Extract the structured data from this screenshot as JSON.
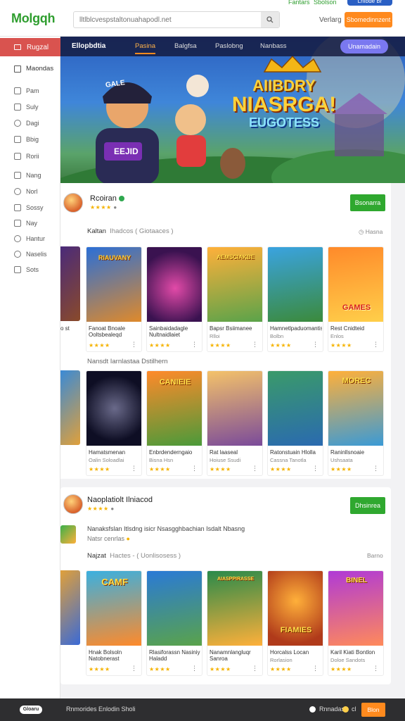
{
  "header": {
    "logo": "Molgqh",
    "search_placeholder": "lltlblcvespstaltonuahapodl.net",
    "top_link_a": "Fantars",
    "top_link_b": "Sbolson",
    "top_pill": "Lnfbde Br",
    "user_link": "Verlarg",
    "primary_button": "Sbomedinnzent"
  },
  "sidebar": {
    "active_item": "Rugzal",
    "main_item": "Maondas",
    "items": [
      "Pam",
      "Suly",
      "Dagi",
      "Bbig",
      "Rorii",
      "Nang",
      "Norl",
      "Sossy",
      "Nay",
      "Hantur",
      "Naselis",
      "Sots"
    ]
  },
  "hero": {
    "brand": "Ellopbdtia",
    "tabs": [
      "Pasina",
      "Balgfsa",
      "Paslobng",
      "Nanbass"
    ],
    "pill": "Unamadain",
    "title_line1": "AIIBDRY",
    "title_line2": "NIASRGA!",
    "title_line3": "EUGOTESS",
    "cap_text": "GALE",
    "shirt_text": "EEJID"
  },
  "section1": {
    "developer": "Rcoiran",
    "follow_button": "Bsonarra",
    "row1_label": "Kaltan",
    "row1_sub": "Ihadcos ( Giotaaces )",
    "row1_more": "Hasna",
    "row1_cards": [
      {
        "title": "Fanoat Bnoale Ooltsbealeqd",
        "sub": "",
        "stars": "★★★★",
        "thumb_text": "RIAUVANY"
      },
      {
        "title": "Sainbaidadagle Nultnaidlaiet",
        "sub": "",
        "stars": "★★★★",
        "thumb_text": ""
      },
      {
        "title": "Bapsr Bsiimanee",
        "sub": "Rlloi",
        "stars": "★★★★",
        "thumb_text": "AEMSCIAKBE"
      },
      {
        "title": "Hamnetlpaduomantis",
        "sub": "Bolbn",
        "stars": "★★★★",
        "thumb_text": ""
      },
      {
        "title": "Rest Cnidteid",
        "sub": "Enlos",
        "stars": "★★★★",
        "thumb_text": "GAMES"
      }
    ],
    "row2_label": "Nansdt Iarnlastaa Dstilhern",
    "row2_cards": [
      {
        "title": "Hamatsmenan",
        "sub": "Oalin Soloadlai",
        "stars": "★★★★",
        "thumb_text": ""
      },
      {
        "title": "Enbrdenderngaio",
        "sub": "Bisna Hsn",
        "stars": "★★★★",
        "thumb_text": "CANIEIE"
      },
      {
        "title": "Rat laaseal",
        "sub": "Hoiuse Ssudi",
        "stars": "★★★★",
        "thumb_text": ""
      },
      {
        "title": "Ratonstuain Hlolla",
        "sub": "Cassna Tanotla",
        "stars": "★★★★",
        "thumb_text": ""
      },
      {
        "title": "Raninllsnoaie",
        "sub": "Ushsaata",
        "stars": "★★★★",
        "thumb_text": "MOREC"
      }
    ]
  },
  "section2": {
    "developer": "Naoplatiolt Ilniacod",
    "follow_button": "Dhsinrea",
    "desc_line1": "Nanaksfslan Itlsdng isicr Nsasgghbachian Isdalt Nbasng",
    "desc_line2": "Natsr cenrlas",
    "row_label": "Najzat",
    "row_sub": "Hactes - ( Uonlisosess )",
    "row_more": "Barno",
    "cards": [
      {
        "title": "Hnak Bolsoln Natobnerast",
        "sub": "",
        "stars": "★★★★",
        "thumb_text": "CAMF"
      },
      {
        "title": "Rlasiforassn Nasiniy Haladd",
        "sub": "",
        "stars": "★★★★",
        "thumb_text": ""
      },
      {
        "title": "Nanamnlangluqr Sanroa",
        "sub": "",
        "stars": "★★★★",
        "thumb_text": "AIASPPIRASSE"
      },
      {
        "title": "Horcalss Locan",
        "sub": "Rorlasion",
        "stars": "★★★★",
        "thumb_text": "FIAMIES"
      },
      {
        "title": "Karil Kiati Bontlon",
        "sub": "Doloe Sandots",
        "stars": "★★★★",
        "thumb_text": "BINEL"
      }
    ]
  },
  "footer": {
    "logo": "Gloaru",
    "text": "Rnmorides Enlodin Sholi",
    "link_a": "Rnnadas",
    "link_b": "cl",
    "button": "Blon"
  },
  "colors": {
    "accent_orange": "#ff8a1e",
    "brand_green": "#2f9e2f",
    "active_red": "#d9534f",
    "follow_green": "#2fa82f"
  }
}
